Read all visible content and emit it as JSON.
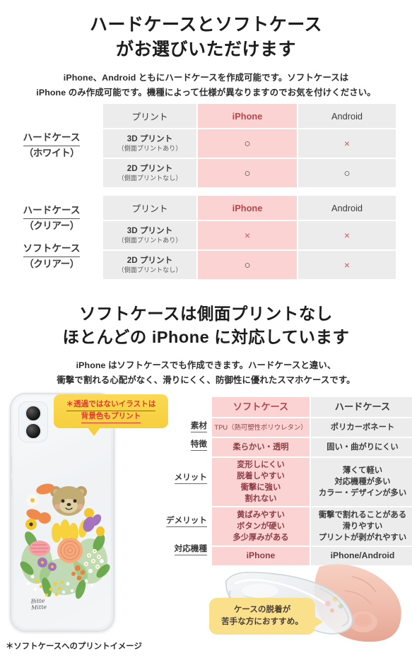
{
  "section_top": {
    "heading_line1": "ハードケースとソフトケース",
    "heading_line2": "がお選びいただけます",
    "sub_line1": "iPhone、Android ともにハードケースを作成可能です。ソフトケースは",
    "sub_line2": "iPhone のみ作成可能です。機種によって仕様が異なりますのでお気を付けください。"
  },
  "compat_table_1": {
    "row_label_line1": "ハードケース",
    "row_label_line2": "（ホワイト）",
    "columns": [
      "プリント",
      "iPhone",
      "Android"
    ],
    "rows": [
      {
        "print_main": "3D プリント",
        "print_sub": "（側面プリントあり）",
        "iphone": "○",
        "android": "×"
      },
      {
        "print_main": "2D プリント",
        "print_sub": "（側面プリントなし）",
        "iphone": "○",
        "android": "○"
      }
    ]
  },
  "compat_table_2": {
    "row_label_a_line1": "ハードケース",
    "row_label_a_line2": "（クリアー）",
    "row_label_b_line1": "ソフトケース",
    "row_label_b_line2": "（クリアー）",
    "columns": [
      "プリント",
      "iPhone",
      "Android"
    ],
    "rows": [
      {
        "print_main": "3D プリント",
        "print_sub": "（側面プリントあり）",
        "iphone": "×",
        "android": "×"
      },
      {
        "print_main": "2D プリント",
        "print_sub": "（側面プリントなし）",
        "iphone": "○",
        "android": "×"
      }
    ]
  },
  "section_mid": {
    "heading_line1": "ソフトケースは側面プリントなし",
    "heading_line2": "ほとんどの iPhone に対応しています",
    "sub_line1": "iPhone はソフトケースでも作成できます。ハードケースと違い、",
    "sub_line2": "衝撃で割れる心配がなく、滑りにくく、防御性に優れたスマホケースです。"
  },
  "comparison_table": {
    "col_soft": "ソフトケース",
    "col_hard": "ハードケース",
    "rows": [
      {
        "label": "素材",
        "soft": [
          "TPU（熱可塑性ポリウレタン）"
        ],
        "hard": [
          "ポリカーボネート"
        ]
      },
      {
        "label": "特徴",
        "soft": [
          "柔らかい・透明"
        ],
        "hard": [
          "固い・曲がりにくい"
        ]
      },
      {
        "label": "メリット",
        "soft": [
          "変形しにくい",
          "脱着しやすい",
          "衝撃に強い",
          "割れない"
        ],
        "hard": [
          "薄くて軽い",
          "対応機種が多い",
          "カラー・デザインが多い"
        ]
      },
      {
        "label": "デメリット",
        "soft": [
          "黄ばみやすい",
          "ボタンが硬い",
          "多少厚みがある"
        ],
        "hard": [
          "衝撃で割れることがある",
          "滑りやすい",
          "プリントが剥がれやすい"
        ]
      },
      {
        "label": "対応機種",
        "soft": [
          "iPhone"
        ],
        "hard": [
          "iPhone/Android"
        ]
      }
    ]
  },
  "callout_top": {
    "line1": "＊透過ではないイラストは",
    "line2": "背景色もプリント"
  },
  "callout_bottom": {
    "line1": "ケースの脱着が",
    "line2": "苦手な方におすすめ。"
  },
  "phone_mock": {
    "signature_line1": "Bitte",
    "signature_line2": "Mitte"
  },
  "footnote": "＊ソフトケースへのプリントイメージ",
  "colors": {
    "pink": "#fbd3d3",
    "gray": "#ececec",
    "pink_text": "#b3474b",
    "x_mark": "#d4565a",
    "callout_yellow": "#f6cf3d",
    "callout_cream": "#fbe08c",
    "callout_red_text": "#e03a2f"
  }
}
